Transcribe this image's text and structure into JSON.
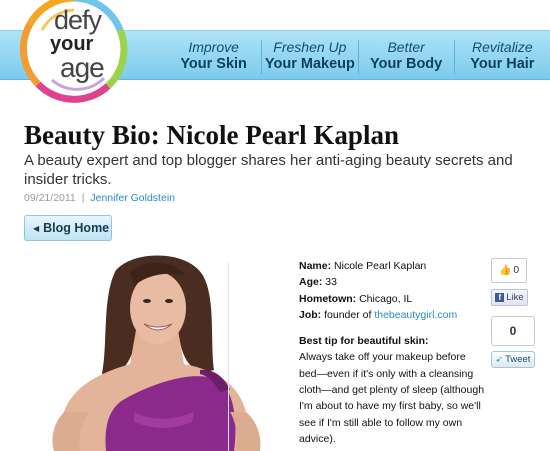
{
  "logo": {
    "line1": "defy",
    "line2": "your",
    "line3": "age"
  },
  "nav": [
    {
      "top": "Improve",
      "bottom": "Your Skin"
    },
    {
      "top": "Freshen Up",
      "bottom": "Your Makeup"
    },
    {
      "top": "Better",
      "bottom": "Your Body"
    },
    {
      "top": "Revitalize",
      "bottom": "Your Hair"
    }
  ],
  "article": {
    "title": "Beauty Bio: Nicole Pearl Kaplan",
    "subtitle": "A beauty expert and top blogger shares her anti-aging beauty secrets and insider tricks.",
    "date": "09/21/2011",
    "separator": "|",
    "author": "Jennifer Goldstein"
  },
  "blog_home_label": "Blog Home",
  "bio": {
    "name_label": "Name:",
    "name": "Nicole Pearl Kaplan",
    "age_label": "Age:",
    "age": "33",
    "hometown_label": "Hometown:",
    "hometown": "Chicago, IL",
    "job_label": "Job:",
    "job_prefix": "founder of",
    "job_link": "thebeautygirl.com",
    "tip_label": "Best tip for beautiful skin:",
    "tip_text": "Always take off your makeup before bed—even if it's only with a cleansing cloth—and get plenty of sleep (although I'm about to have my first baby, so we'll see if I'm still able to follow my own advice)."
  },
  "social": {
    "fb_count": "0",
    "fb_like_label": "Like",
    "tweet_count": "0",
    "tweet_label": "Tweet"
  },
  "colors": {
    "nav_band": "#8fd2ee",
    "nav_text": "#0f3f5c",
    "link": "#2a8ac4",
    "dress": "#8b2a8a"
  },
  "icons": [
    "logo-ring-icon",
    "thumbs-up-icon",
    "facebook-icon",
    "twitter-bird-icon",
    "left-arrow-icon"
  ]
}
